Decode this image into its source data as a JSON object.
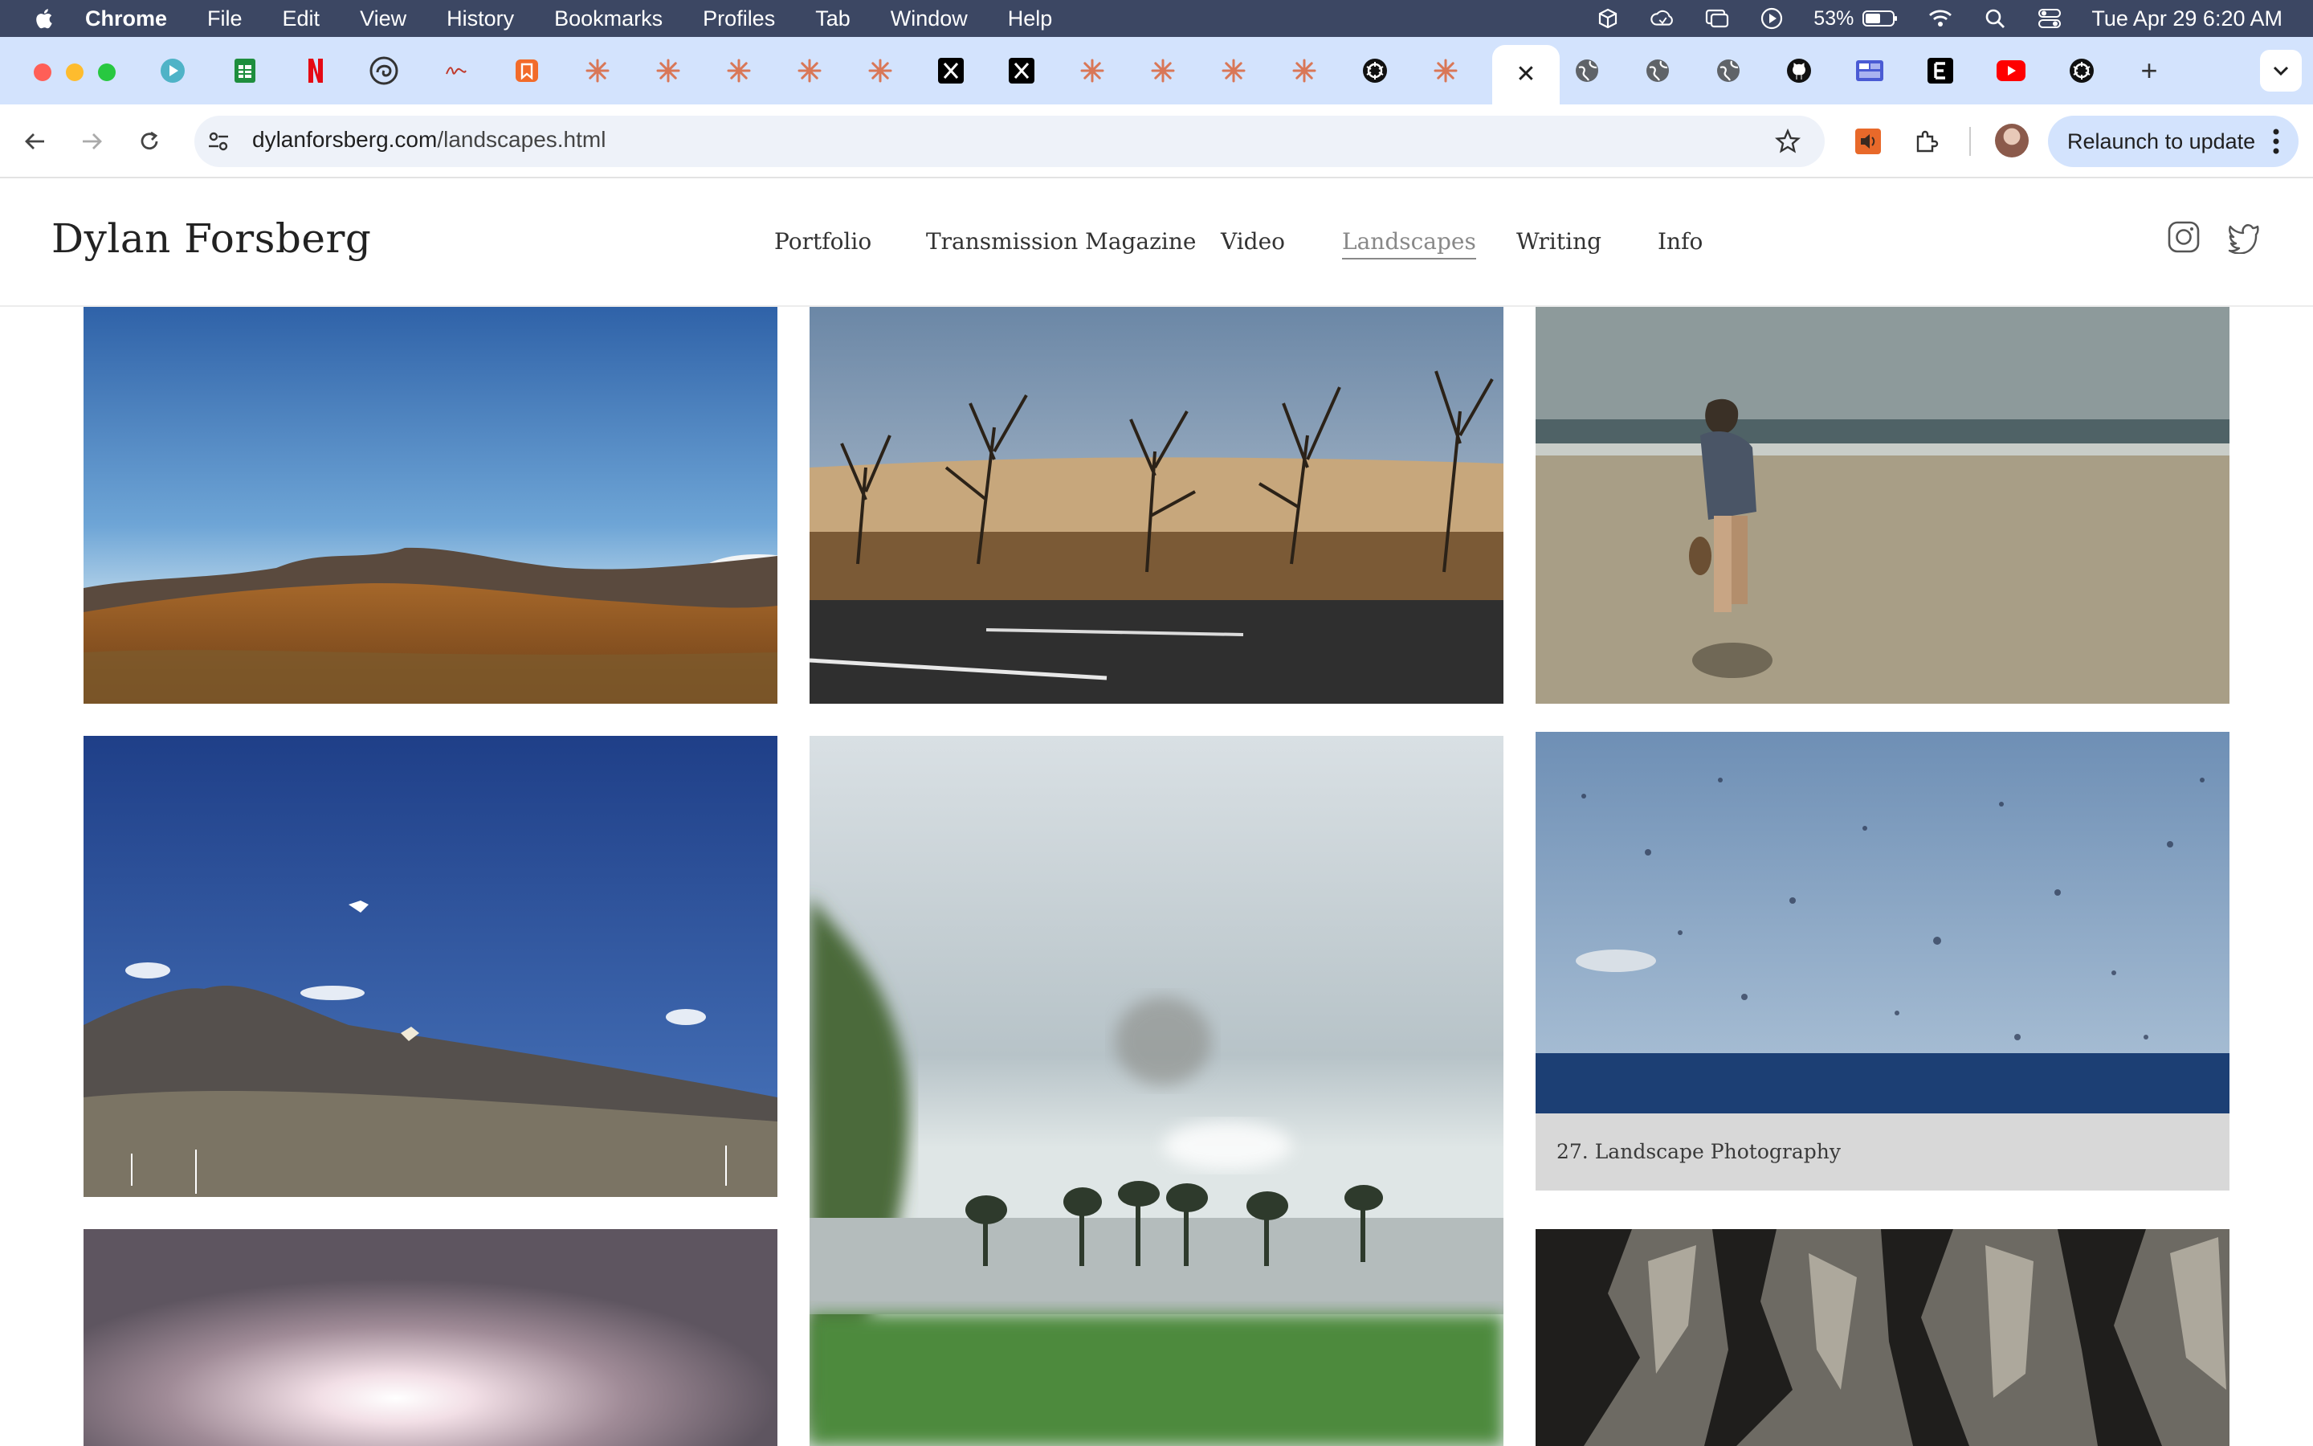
{
  "menubar": {
    "app_name": "Chrome",
    "items": [
      "File",
      "Edit",
      "View",
      "History",
      "Bookmarks",
      "Profiles",
      "Tab",
      "Window",
      "Help"
    ],
    "battery": "53%",
    "clock": "Tue Apr 29  6:20 AM"
  },
  "tabs": {
    "active_close": "✕",
    "new_tab": "+"
  },
  "toolbar": {
    "url_domain": "dylanforsberg.com",
    "url_path": "/landscapes.html",
    "relaunch_label": "Relaunch to update"
  },
  "site": {
    "title": "Dylan Forsberg",
    "nav": [
      "Portfolio",
      "Transmission Magazine",
      "Video",
      "Landscapes",
      "Writing",
      "Info"
    ],
    "active_nav": "Landscapes"
  },
  "gallery": {
    "caption": "27. Landscape Photography"
  },
  "colors": {
    "menubar": "#3c4763",
    "tabstrip": "#d3e3fd",
    "omnibox": "#eef2f9",
    "claude_orange": "#d97757"
  }
}
